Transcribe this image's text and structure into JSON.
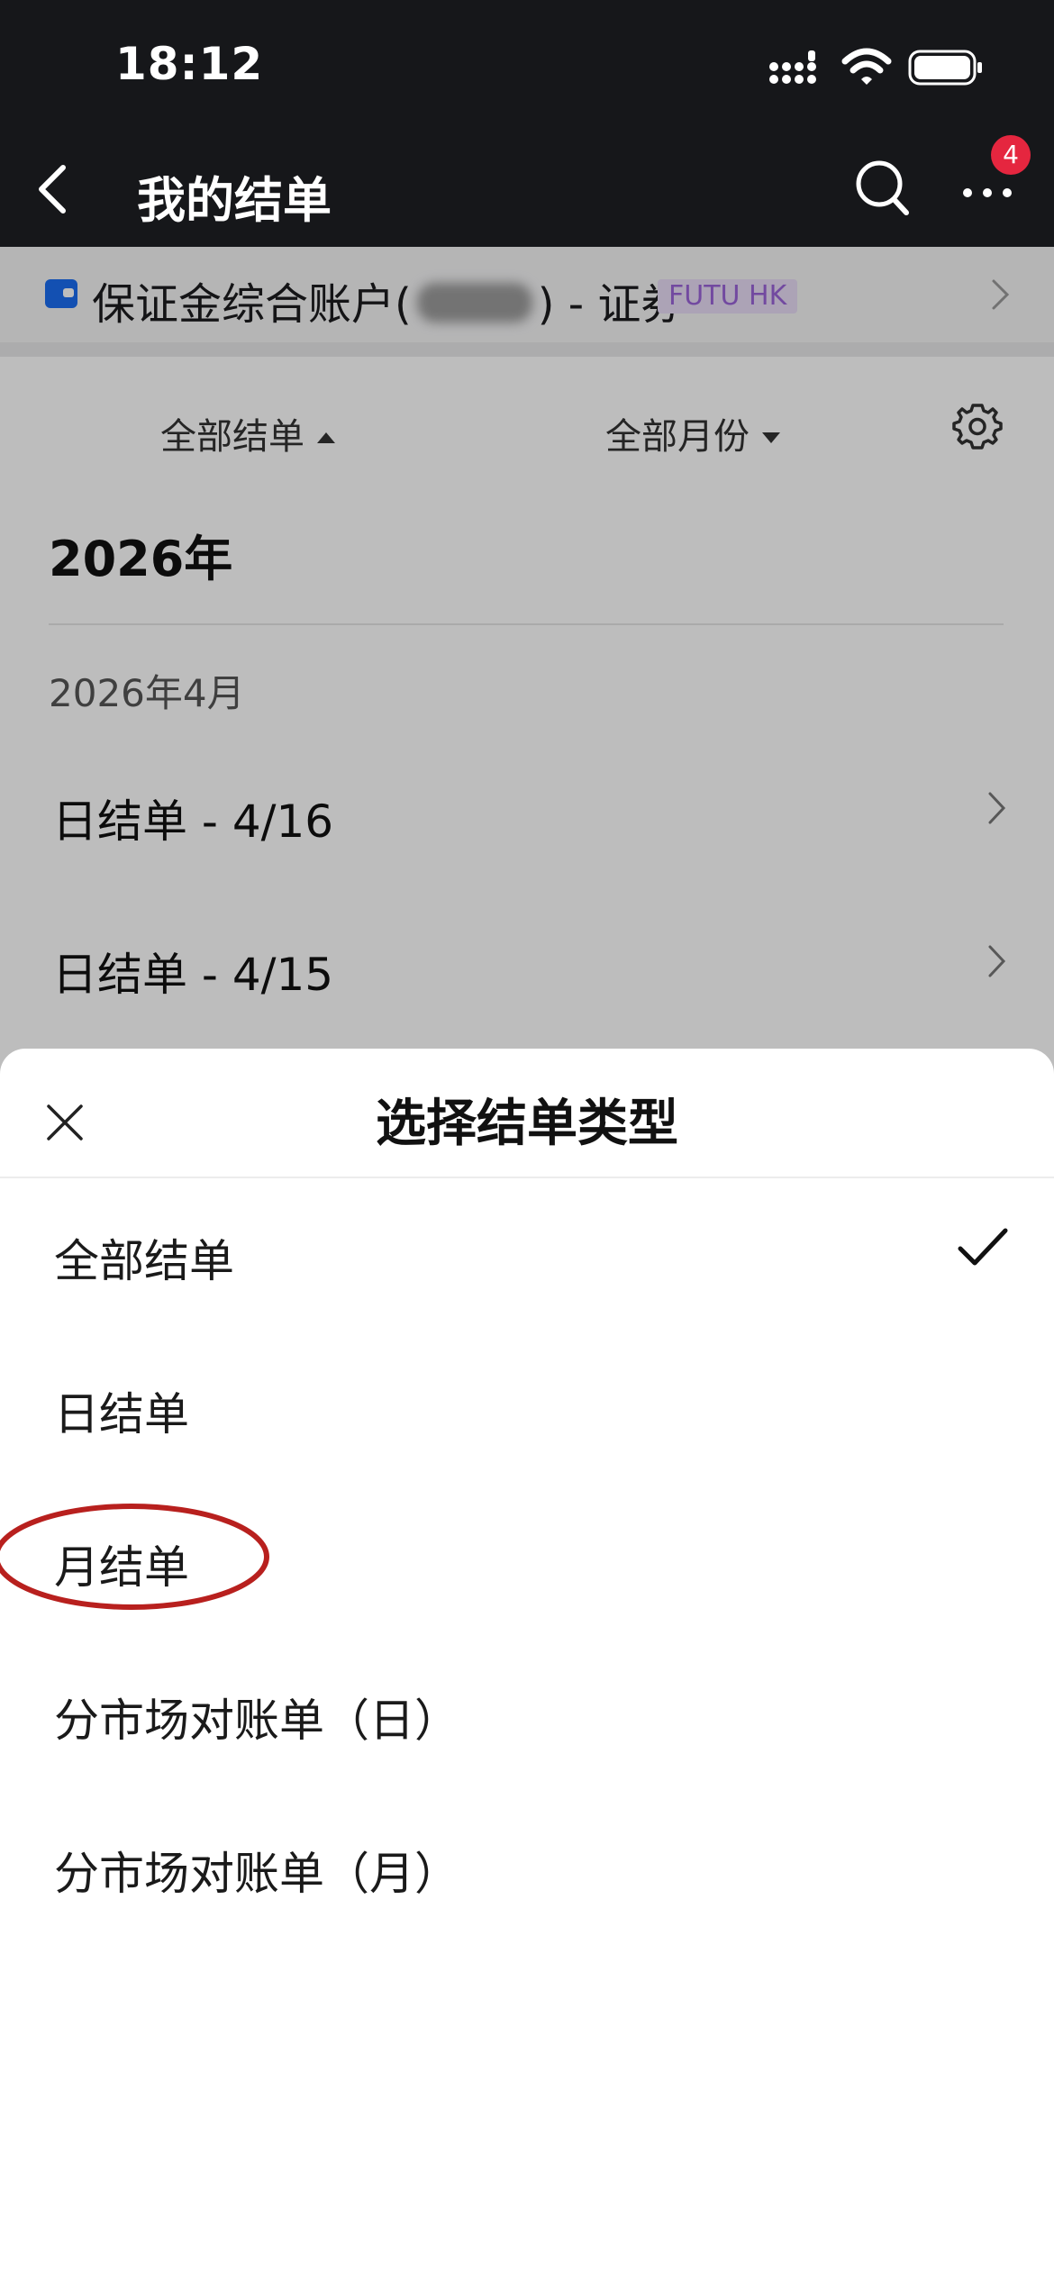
{
  "status_bar": {
    "time": "18:12",
    "icons": [
      "signal-icon",
      "wifi-icon",
      "battery-icon"
    ]
  },
  "nav": {
    "title": "我的结单",
    "notification_count": "4",
    "icons": [
      "back-icon",
      "search-icon",
      "more-icon"
    ]
  },
  "account": {
    "name": "保证金综合账户",
    "open_paren": "(",
    "close_paren": ")",
    "suffix": " - 证券",
    "badge": "FUTU HK",
    "badge_color": "#9a63d8",
    "icon": "wallet-icon"
  },
  "filters": {
    "type_label": "全部结单",
    "month_label": "全部月份",
    "settings_icon": "gear-icon"
  },
  "statements": {
    "year": "2026年",
    "month": "2026年4月",
    "rows": [
      {
        "label": "日结单 - 4/16"
      },
      {
        "label": "日结单 - 4/15"
      }
    ]
  },
  "sheet": {
    "title": "选择结单类型",
    "close_icon": "close-icon",
    "options": [
      {
        "label": "全部结单",
        "selected": true
      },
      {
        "label": "日结单",
        "selected": false
      },
      {
        "label": "月结单",
        "selected": false
      },
      {
        "label": "分市场对账单（日）",
        "selected": false
      },
      {
        "label": "分市场对账单（月）",
        "selected": false
      }
    ],
    "check_icon": "checkmark-icon",
    "highlight_color": "#b8201e"
  },
  "colors": {
    "header_bg": "#16171a",
    "badge_red": "#e5263f",
    "accent_blue": "#1a6cf0"
  }
}
